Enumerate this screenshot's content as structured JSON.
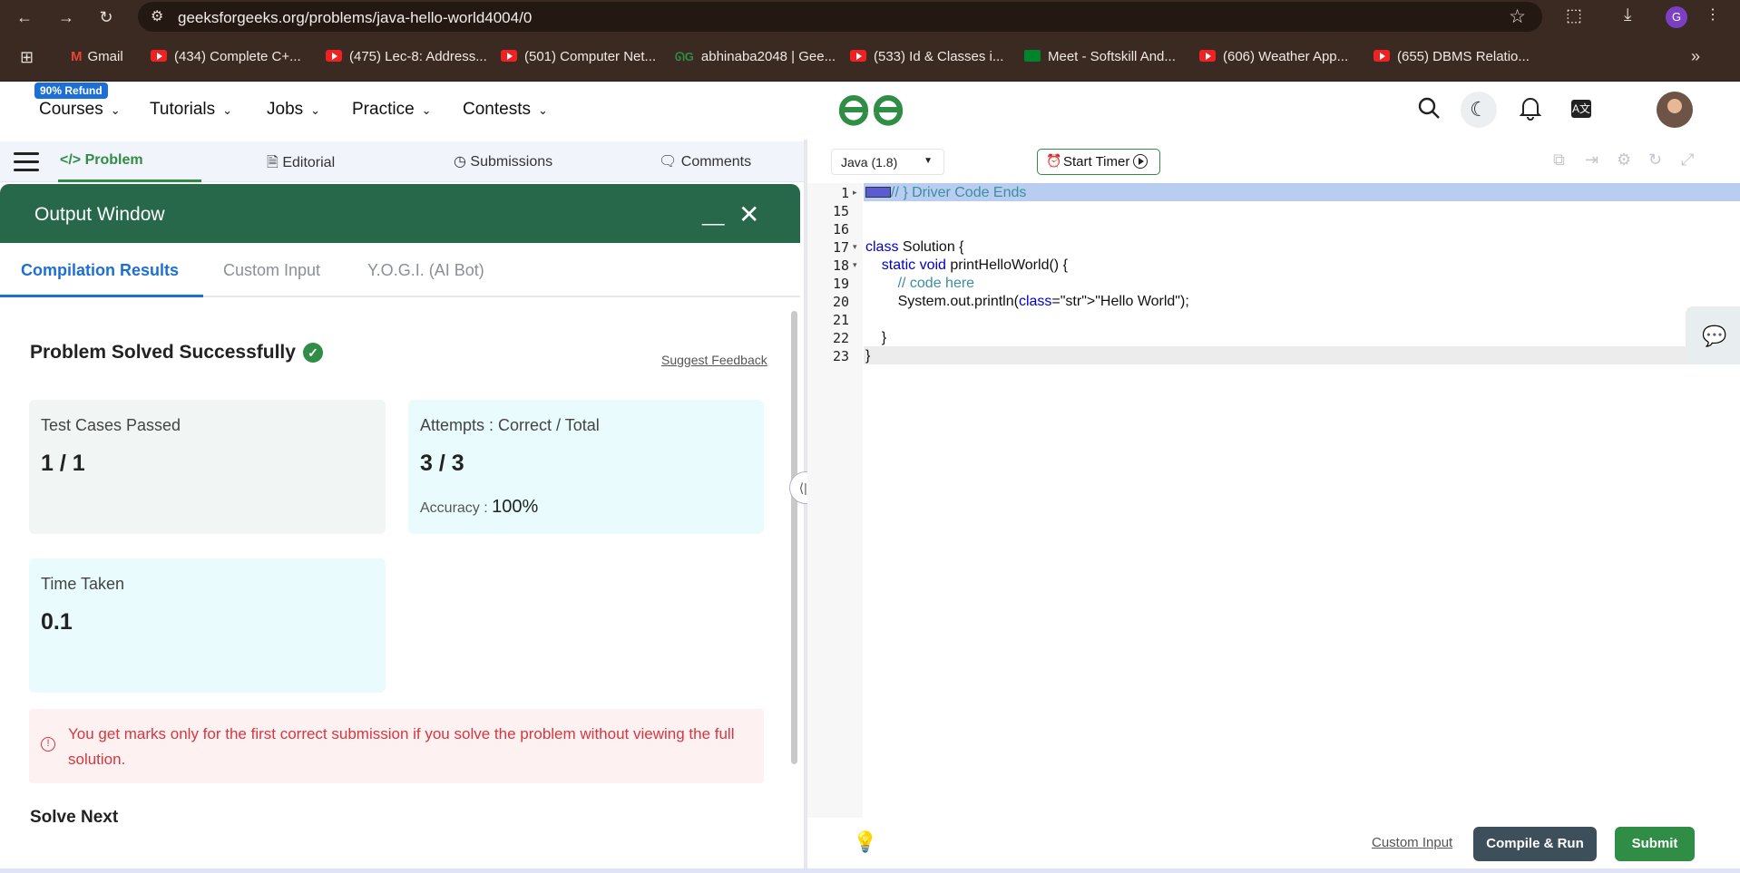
{
  "browser": {
    "url": "geeksforgeeks.org/problems/java-hello-world4004/0",
    "profile_initial": "G",
    "bookmarks": [
      "Gmail",
      "(434) Complete C+...",
      "(475) Lec-8: Address...",
      "(501) Computer Net...",
      "abhinaba2048 | Gee...",
      "(533) Id & Classes i...",
      "Meet - Softskill And...",
      "(606) Weather App...",
      "(655) DBMS Relatio..."
    ]
  },
  "site": {
    "refund_badge": "90% Refund",
    "nav": [
      "Courses",
      "Tutorials",
      "Jobs",
      "Practice",
      "Contests"
    ],
    "logo": "GfG",
    "icons": [
      "search-icon",
      "moon-icon",
      "bell-icon",
      "translate-icon",
      "avatar"
    ]
  },
  "problem_tabs": {
    "problem": "Problem",
    "editorial": "Editorial",
    "submissions": "Submissions",
    "comments": "Comments"
  },
  "output": {
    "title": "Output Window",
    "minimize": "__",
    "close": "✕",
    "tabs": [
      "Compilation Results",
      "Custom Input",
      "Y.O.G.I. (AI Bot)"
    ],
    "status": "Problem Solved Successfully",
    "suggest_feedback": "Suggest Feedback",
    "test_cases_label": "Test Cases Passed",
    "test_cases_value": "1 / 1",
    "attempts_label": "Attempts : Correct / Total",
    "attempts_value": "3 / 3",
    "accuracy_label": "Accuracy :",
    "accuracy_value": "100%",
    "time_label": "Time Taken",
    "time_value": "0.1",
    "warning": "You get marks only for the first correct submission if you solve the problem without viewing the full solution.",
    "solve_next": "Solve Next"
  },
  "editor": {
    "language": "Java (1.8)",
    "start_timer": "Start Timer",
    "lines": [
      {
        "n": "1",
        "text": "// } Driver Code Ends"
      },
      {
        "n": "15",
        "text": ""
      },
      {
        "n": "16",
        "text": ""
      },
      {
        "n": "17",
        "text": "class Solution {"
      },
      {
        "n": "18",
        "text": "    static void printHelloWorld() {"
      },
      {
        "n": "19",
        "text": "        // code here"
      },
      {
        "n": "20",
        "text": "        System.out.println(\"Hello World\");"
      },
      {
        "n": "21",
        "text": ""
      },
      {
        "n": "22",
        "text": "    }"
      },
      {
        "n": "23",
        "text": "}"
      }
    ],
    "custom_input": "Custom Input",
    "compile_run": "Compile & Run",
    "submit": "Submit"
  },
  "colors": {
    "brand_green": "#2f8d46",
    "output_header": "#27674a",
    "link_blue": "#1d6fd6",
    "warning_red": "#d7373f"
  }
}
